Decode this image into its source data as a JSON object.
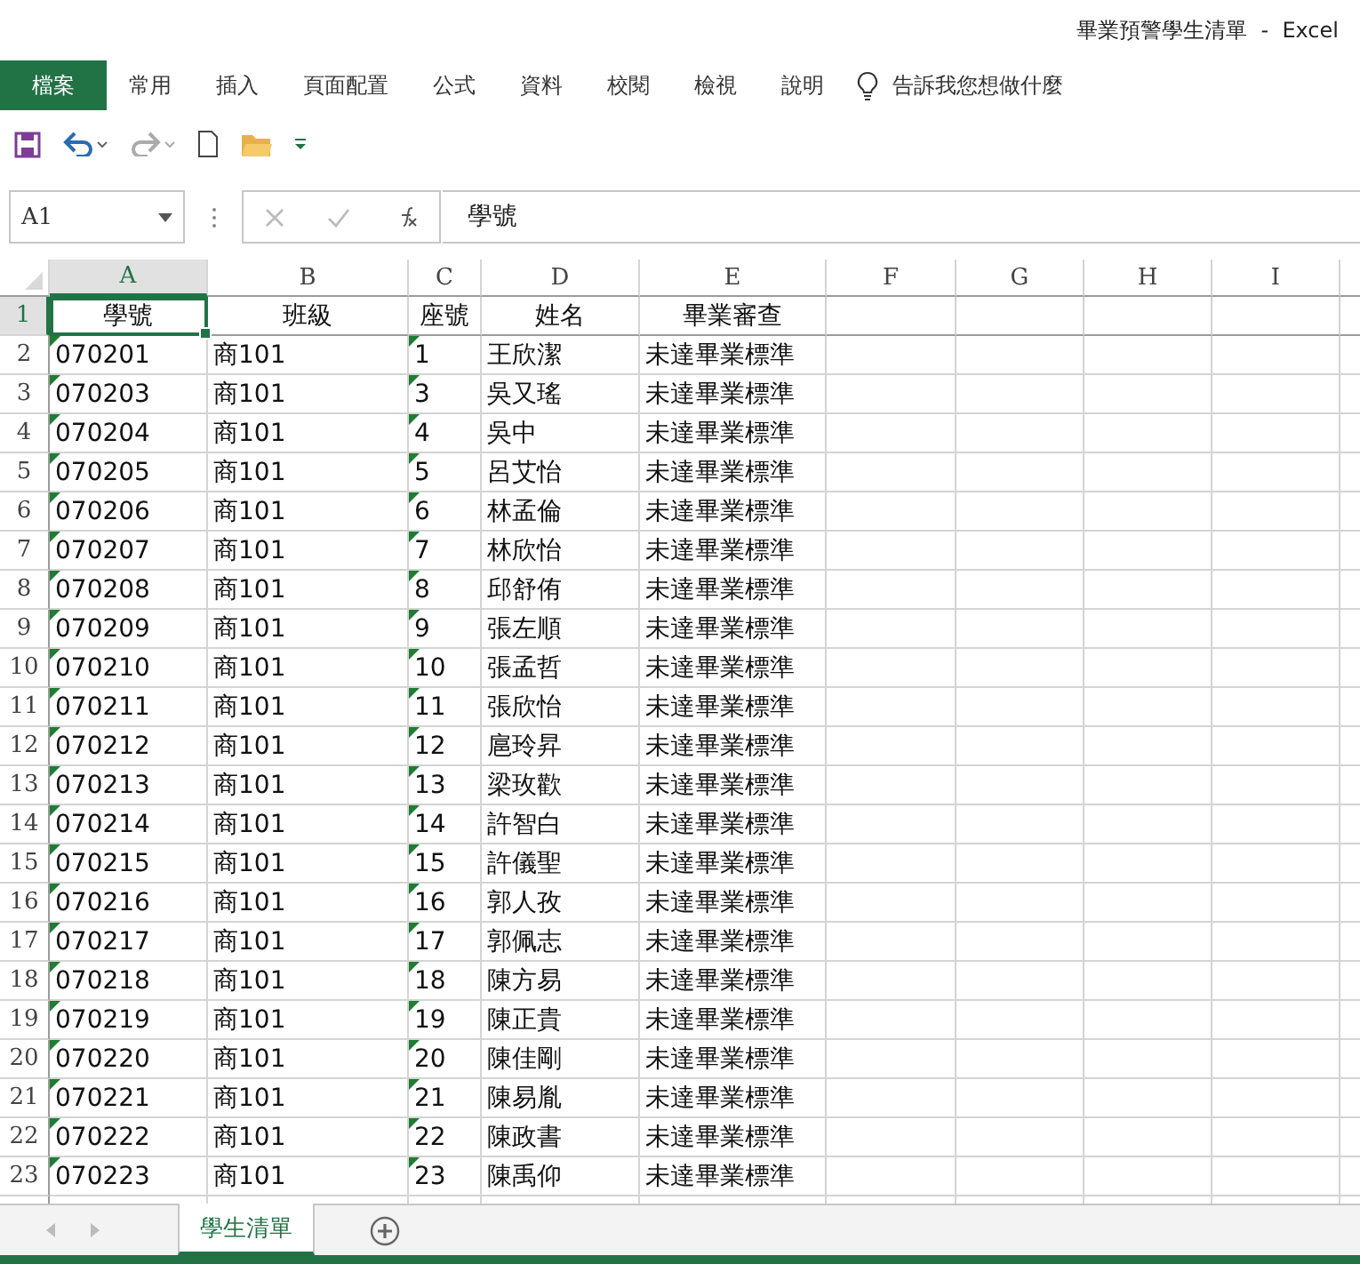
{
  "window": {
    "title": "畢業預警學生清單  -  Excel"
  },
  "ribbon_tabs": [
    {
      "label": "檔案",
      "kind": "file",
      "selected": false
    },
    {
      "label": "常用",
      "kind": "tab",
      "selected": false
    },
    {
      "label": "插入",
      "kind": "tab",
      "selected": false
    },
    {
      "label": "頁面配置",
      "kind": "tab",
      "selected": false
    },
    {
      "label": "公式",
      "kind": "tab",
      "selected": false
    },
    {
      "label": "資料",
      "kind": "tab",
      "selected": false
    },
    {
      "label": "校閱",
      "kind": "tab",
      "selected": false
    },
    {
      "label": "檢視",
      "kind": "tab",
      "selected": false
    },
    {
      "label": "說明",
      "kind": "tab",
      "selected": false
    }
  ],
  "tell_me": {
    "placeholder": "告訴我您想做什麼"
  },
  "formula_bar": {
    "name_box": "A1",
    "value": "學號"
  },
  "sheet": {
    "columns": [
      {
        "label": "A",
        "selected": true
      },
      {
        "label": "B",
        "selected": false
      },
      {
        "label": "C",
        "selected": false
      },
      {
        "label": "D",
        "selected": false
      },
      {
        "label": "E",
        "selected": false
      },
      {
        "label": "F",
        "selected": false
      },
      {
        "label": "G",
        "selected": false
      },
      {
        "label": "H",
        "selected": false
      },
      {
        "label": "I",
        "selected": false
      }
    ],
    "rows": [
      {
        "number": "1",
        "selected": true,
        "flagged": false,
        "kind": "header",
        "cells": [
          "學號",
          "班級",
          "座號",
          "姓名",
          "畢業審查"
        ]
      },
      {
        "number": "2",
        "selected": false,
        "flagged": true,
        "kind": "data",
        "cells": [
          "070201",
          "商101",
          "1",
          "王欣潔",
          "未達畢業標準"
        ]
      },
      {
        "number": "3",
        "selected": false,
        "flagged": true,
        "kind": "data",
        "cells": [
          "070203",
          "商101",
          "3",
          "吳又瑤",
          "未達畢業標準"
        ]
      },
      {
        "number": "4",
        "selected": false,
        "flagged": true,
        "kind": "data",
        "cells": [
          "070204",
          "商101",
          "4",
          "吳中",
          "未達畢業標準"
        ]
      },
      {
        "number": "5",
        "selected": false,
        "flagged": true,
        "kind": "data",
        "cells": [
          "070205",
          "商101",
          "5",
          "呂艾怡",
          "未達畢業標準"
        ]
      },
      {
        "number": "6",
        "selected": false,
        "flagged": true,
        "kind": "data",
        "cells": [
          "070206",
          "商101",
          "6",
          "林孟倫",
          "未達畢業標準"
        ]
      },
      {
        "number": "7",
        "selected": false,
        "flagged": true,
        "kind": "data",
        "cells": [
          "070207",
          "商101",
          "7",
          "林欣怡",
          "未達畢業標準"
        ]
      },
      {
        "number": "8",
        "selected": false,
        "flagged": true,
        "kind": "data",
        "cells": [
          "070208",
          "商101",
          "8",
          "邱舒侑",
          "未達畢業標準"
        ]
      },
      {
        "number": "9",
        "selected": false,
        "flagged": true,
        "kind": "data",
        "cells": [
          "070209",
          "商101",
          "9",
          "張左順",
          "未達畢業標準"
        ]
      },
      {
        "number": "10",
        "selected": false,
        "flagged": true,
        "kind": "data",
        "cells": [
          "070210",
          "商101",
          "10",
          "張孟哲",
          "未達畢業標準"
        ]
      },
      {
        "number": "11",
        "selected": false,
        "flagged": true,
        "kind": "data",
        "cells": [
          "070211",
          "商101",
          "11",
          "張欣怡",
          "未達畢業標準"
        ]
      },
      {
        "number": "12",
        "selected": false,
        "flagged": true,
        "kind": "data",
        "cells": [
          "070212",
          "商101",
          "12",
          "扈玲昇",
          "未達畢業標準"
        ]
      },
      {
        "number": "13",
        "selected": false,
        "flagged": true,
        "kind": "data",
        "cells": [
          "070213",
          "商101",
          "13",
          "梁玫歡",
          "未達畢業標準"
        ]
      },
      {
        "number": "14",
        "selected": false,
        "flagged": true,
        "kind": "data",
        "cells": [
          "070214",
          "商101",
          "14",
          "許智白",
          "未達畢業標準"
        ]
      },
      {
        "number": "15",
        "selected": false,
        "flagged": true,
        "kind": "data",
        "cells": [
          "070215",
          "商101",
          "15",
          "許儀聖",
          "未達畢業標準"
        ]
      },
      {
        "number": "16",
        "selected": false,
        "flagged": true,
        "kind": "data",
        "cells": [
          "070216",
          "商101",
          "16",
          "郭人孜",
          "未達畢業標準"
        ]
      },
      {
        "number": "17",
        "selected": false,
        "flagged": true,
        "kind": "data",
        "cells": [
          "070217",
          "商101",
          "17",
          "郭佩志",
          "未達畢業標準"
        ]
      },
      {
        "number": "18",
        "selected": false,
        "flagged": true,
        "kind": "data",
        "cells": [
          "070218",
          "商101",
          "18",
          "陳方易",
          "未達畢業標準"
        ]
      },
      {
        "number": "19",
        "selected": false,
        "flagged": true,
        "kind": "data",
        "cells": [
          "070219",
          "商101",
          "19",
          "陳正貴",
          "未達畢業標準"
        ]
      },
      {
        "number": "20",
        "selected": false,
        "flagged": true,
        "kind": "data",
        "cells": [
          "070220",
          "商101",
          "20",
          "陳佳剛",
          "未達畢業標準"
        ]
      },
      {
        "number": "21",
        "selected": false,
        "flagged": true,
        "kind": "data",
        "cells": [
          "070221",
          "商101",
          "21",
          "陳易胤",
          "未達畢業標準"
        ]
      },
      {
        "number": "22",
        "selected": false,
        "flagged": true,
        "kind": "data",
        "cells": [
          "070222",
          "商101",
          "22",
          "陳政書",
          "未達畢業標準"
        ]
      },
      {
        "number": "23",
        "selected": false,
        "flagged": true,
        "kind": "data",
        "cells": [
          "070223",
          "商101",
          "23",
          "陳禹仰",
          "未達畢業標準"
        ]
      }
    ]
  },
  "sheet_tabs": [
    {
      "label": "學生清單",
      "selected": true
    }
  ]
}
